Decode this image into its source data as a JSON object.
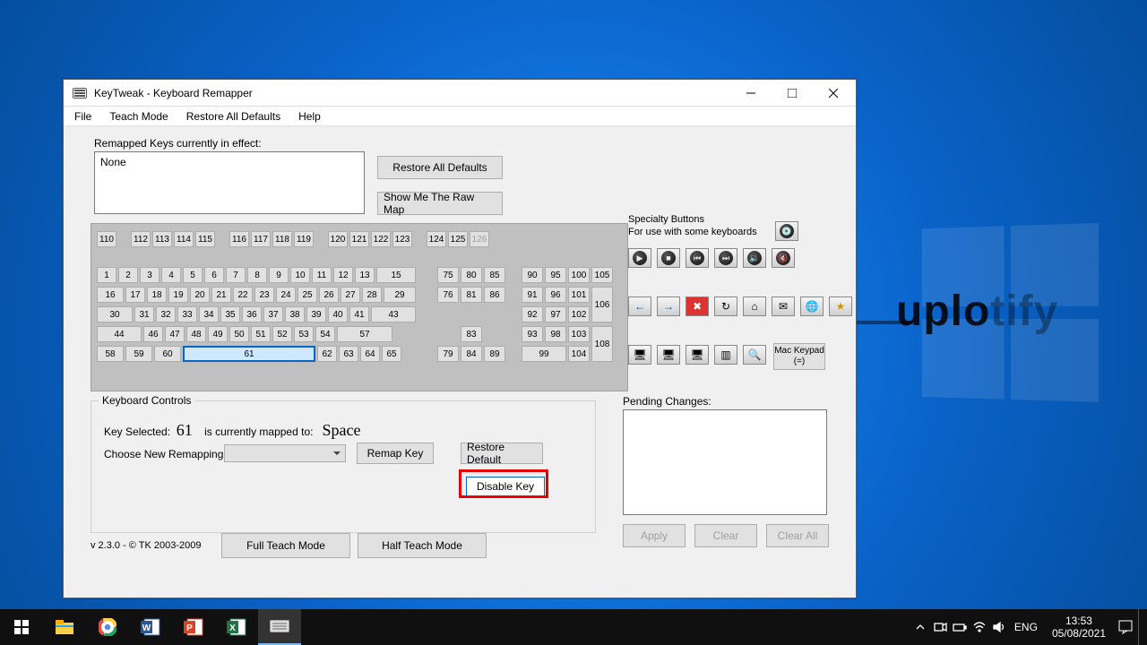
{
  "window": {
    "title": "KeyTweak -  Keyboard Remapper"
  },
  "menu": [
    "File",
    "Teach Mode",
    "Restore All Defaults",
    "Help"
  ],
  "remapped": {
    "label": "Remapped Keys currently in effect:",
    "value": "None"
  },
  "buttons": {
    "restoreAll": "Restore All Defaults",
    "rawMap": "Show Me The Raw Map",
    "remap": "Remap Key",
    "restoreDefault": "Restore Default",
    "disable": "Disable Key",
    "fullTeach": "Full Teach Mode",
    "halfTeach": "Half Teach Mode",
    "apply": "Apply",
    "clear": "Clear",
    "clearAll": "Clear All"
  },
  "controls": {
    "legend": "Keyboard Controls",
    "keySelLabel": "Key Selected:",
    "keySel": "61",
    "mappedLabel": "is currently mapped to:",
    "mappedTo": "Space",
    "choose": "Choose New Remapping"
  },
  "version": "v 2.3.0 - © TK 2003-2009",
  "pending": "Pending Changes:",
  "specialty": {
    "l1": "Specialty Buttons",
    "l2": "For use with some keyboards",
    "mac": "Mac Keypad (=)"
  },
  "taskbar": {
    "lang": "ENG",
    "time": "13:53",
    "date": "05/08/2021"
  },
  "watermark": {
    "a": "uplo",
    "b": "tify"
  },
  "keyboard": {
    "row0": [
      110,
      null,
      112,
      113,
      114,
      115,
      null,
      116,
      117,
      118,
      119,
      null,
      120,
      121,
      122,
      123,
      null,
      124,
      125,
      126
    ],
    "row1": [
      1,
      2,
      3,
      4,
      5,
      6,
      7,
      8,
      9,
      10,
      11,
      12,
      13,
      15
    ],
    "row2": [
      16,
      17,
      18,
      19,
      20,
      21,
      22,
      23,
      24,
      25,
      26,
      27,
      28,
      29
    ],
    "row3": [
      30,
      31,
      32,
      33,
      34,
      35,
      36,
      37,
      38,
      39,
      40,
      41,
      43
    ],
    "row4": [
      44,
      46,
      47,
      48,
      49,
      50,
      51,
      52,
      53,
      54,
      57
    ],
    "row5": [
      58,
      59,
      60,
      61,
      62,
      63,
      64,
      65
    ],
    "nav1": [
      75,
      80,
      85
    ],
    "nav2": [
      76,
      81,
      86
    ],
    "arrow_up": 83,
    "arrow_lrd": [
      79,
      84,
      89
    ],
    "np1": [
      90,
      95,
      100,
      105
    ],
    "np2": [
      91,
      96,
      101
    ],
    "np3": [
      92,
      97,
      102
    ],
    "np4": [
      93,
      98,
      103
    ],
    "np5": [
      99,
      104
    ],
    "np_tall": [
      106,
      108
    ]
  }
}
